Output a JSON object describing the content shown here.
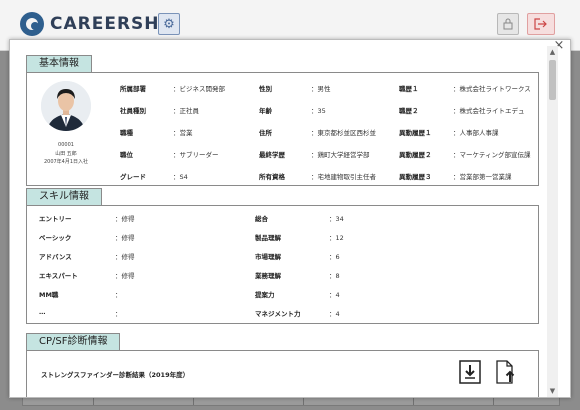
{
  "app": {
    "brand": "CAREERSHIP"
  },
  "modal": {
    "close_glyph": "×",
    "sections": {
      "basic_info": {
        "title": "基本情報",
        "profile": {
          "id": "00001",
          "name": "山田 五郎",
          "joined": "2007年4月1日入社"
        },
        "fields": [
          {
            "label": "所属部署",
            "value": "：ビジネス開発部"
          },
          {
            "label": "性別",
            "value": "：男性"
          },
          {
            "label": "職歴１",
            "value": "：株式会社ライトワークス"
          },
          {
            "label": "社員種別",
            "value": "：正社員"
          },
          {
            "label": "年齢",
            "value": "：35"
          },
          {
            "label": "職歴２",
            "value": "：株式会社ライトエデュ"
          },
          {
            "label": "職種",
            "value": "：営業"
          },
          {
            "label": "住所",
            "value": "：東京都杉並区西杉並"
          },
          {
            "label": "異動履歴１",
            "value": "：人事部人事課"
          },
          {
            "label": "職位",
            "value": "：サブリーダー"
          },
          {
            "label": "最終学歴",
            "value": "：鶏町大学経営学部"
          },
          {
            "label": "異動履歴２",
            "value": "：マーケティング部宣伝課"
          },
          {
            "label": "グレード",
            "value": "：S4"
          },
          {
            "label": "所有資格",
            "value": "：宅地建物取引主任者"
          },
          {
            "label": "異動履歴３",
            "value": "：営業部第一営業課"
          }
        ]
      },
      "skill_info": {
        "title": "スキル情報",
        "fields": [
          {
            "label": "エントリー",
            "value": "：修得"
          },
          {
            "label": "総合",
            "value": "：34"
          },
          {
            "label": "ベーシック",
            "value": "：修得"
          },
          {
            "label": "製品理解",
            "value": "：12"
          },
          {
            "label": "アドバンス",
            "value": "：修得"
          },
          {
            "label": "市場理解",
            "value": "：6"
          },
          {
            "label": "エキスパート",
            "value": "：修得"
          },
          {
            "label": "業務理解",
            "value": "：8"
          },
          {
            "label": "MM職",
            "value": "："
          },
          {
            "label": "提案力",
            "value": "：4"
          },
          {
            "label": "…",
            "value": "："
          },
          {
            "label": "マネジメント力",
            "value": "：4"
          }
        ]
      },
      "cpsf": {
        "title": "CP/SF診断情報",
        "result_label": "ストレングスファインダー診断結果（2019年度）"
      }
    }
  },
  "colors": {
    "section_tab": "#c5e4e1",
    "brand": "#2f5f8e",
    "logout": "#c44444"
  },
  "icons": [
    "brand-logo-icon",
    "gear-icon",
    "lock-icon",
    "logout-icon",
    "close-icon",
    "download-icon",
    "upload-icon",
    "scroll-up-icon",
    "scroll-down-icon"
  ]
}
